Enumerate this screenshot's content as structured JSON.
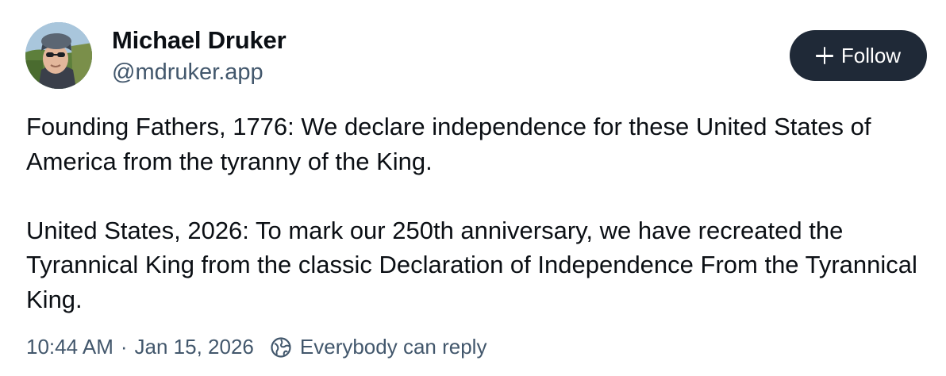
{
  "author": {
    "name": "Michael Druker",
    "handle": "@mdruker.app"
  },
  "follow_button": {
    "label": "Follow",
    "icon": "plus-icon"
  },
  "post": {
    "paragraphs": [
      "Founding Fathers, 1776: We declare independence for these United States of America from the tyranny of the King.",
      "United States, 2026: To mark our 250th anniversary, we have recreated the Tyrannical King from the classic Declaration of Independence From the Tyrannical King."
    ]
  },
  "meta": {
    "time": "10:44 AM",
    "separator": "·",
    "date": "Jan 15, 2026",
    "reply_setting": "Everybody can reply",
    "reply_icon": "globe-icon"
  },
  "colors": {
    "text": "#0b0f14",
    "muted": "#42576c",
    "follow_bg": "#1f2937"
  }
}
